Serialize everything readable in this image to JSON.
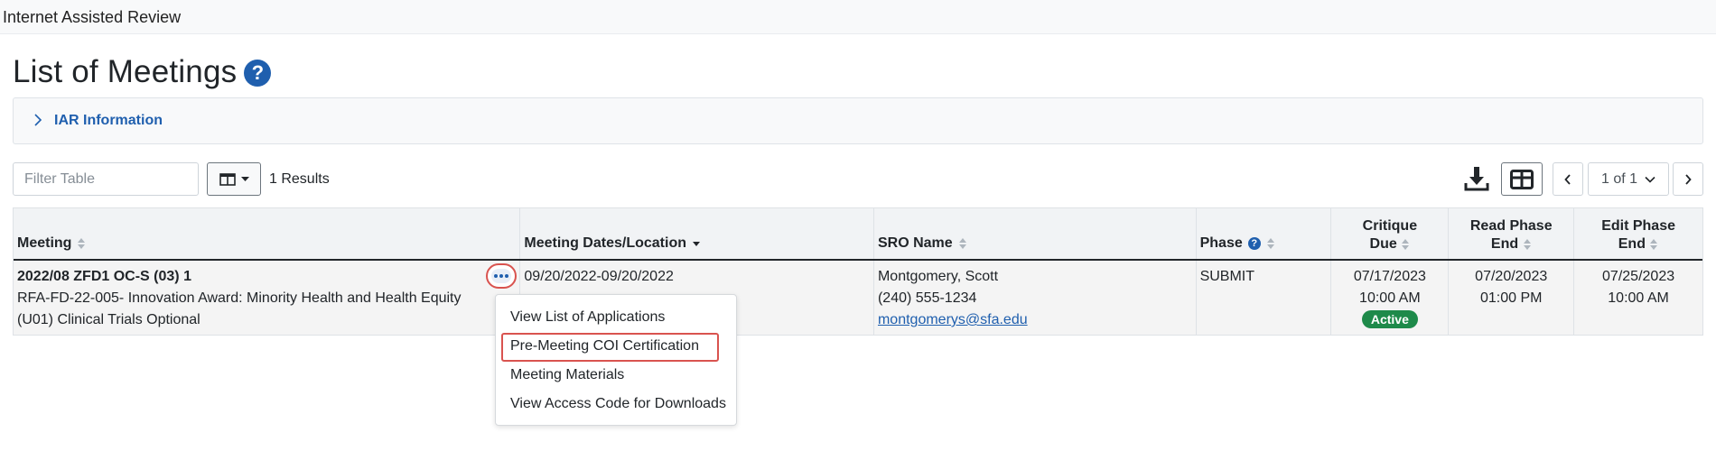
{
  "app": {
    "title": "Internet Assisted Review"
  },
  "page": {
    "title": "List of Meetings"
  },
  "icons": {
    "help": "question-circle-icon",
    "chevron_right": "chevron-right-icon",
    "columns": "columns-icon",
    "caret_down": "caret-down-icon",
    "download": "download-icon",
    "grid": "grid-view-icon",
    "ellipsis": "ellipsis-icon",
    "sort": "sort-icon",
    "sort_desc": "sort-desc-icon"
  },
  "accordion": {
    "label": "IAR Information"
  },
  "toolbar": {
    "filter_placeholder": "Filter Table",
    "results": "1 Results",
    "pagination": "1 of 1"
  },
  "table": {
    "headers": {
      "meeting": "Meeting",
      "dates": "Meeting Dates/Location",
      "sro": "SRO Name",
      "phase": "Phase",
      "critique_line1": "Critique",
      "critique_line2": "Due",
      "read_line1": "Read Phase",
      "read_line2": "End",
      "edit_line1": "Edit Phase",
      "edit_line2": "End"
    },
    "rows": [
      {
        "meeting_id": "2022/08 ZFD1 OC-S (03) 1",
        "meeting_desc_line1": "RFA-FD-22-005- Innovation Award: Minority Health and Health Equity",
        "meeting_desc_line2": "(U01) Clinical Trials Optional",
        "dates": "09/20/2022-09/20/2022",
        "sro_name": "Montgomery, Scott",
        "sro_phone": "(240) 555-1234",
        "sro_email": "montgomerys@sfa.edu",
        "phase": "SUBMIT",
        "critique_date": "07/17/2023",
        "critique_time": "10:00 AM",
        "critique_status": "Active",
        "read_date": "07/20/2023",
        "read_time": "01:00 PM",
        "edit_date": "07/25/2023",
        "edit_time": "10:00 AM"
      }
    ]
  },
  "action_menu": {
    "items": [
      "View List of Applications",
      "Pre-Meeting COI Certification",
      "Meeting Materials",
      "View Access Code for Downloads"
    ]
  },
  "colors": {
    "link": "#1f5fae",
    "highlight_border": "#d9534f",
    "active_badge": "#1e8a4a"
  }
}
